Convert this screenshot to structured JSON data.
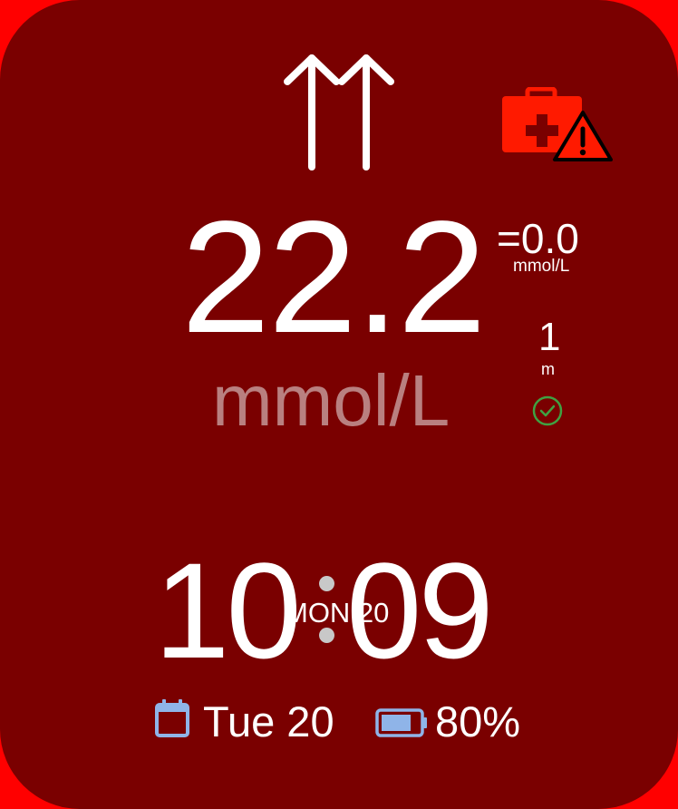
{
  "glucose": {
    "value": "22.2",
    "unit": "mmol/L",
    "trend_icon": "double-up-arrow-icon",
    "delta": "=0.0",
    "delta_unit": "mmol/L",
    "reading_age": "1",
    "reading_age_unit": "m"
  },
  "status": {
    "alert_icon": "medical-kit-warning-icon",
    "sync_icon": "checkmark-circle-icon"
  },
  "clock": {
    "hours": "10",
    "minutes": "09",
    "day_label": "MON 20"
  },
  "footer": {
    "date": "Tue 20",
    "battery": "80%",
    "battery_level": 0.8
  },
  "colors": {
    "background": "#ff0000",
    "face": "#7a0000",
    "text": "#ffffff",
    "unit_text": "#b98080",
    "check": "#3fa142",
    "icon_blue": "#8fb4e8"
  }
}
